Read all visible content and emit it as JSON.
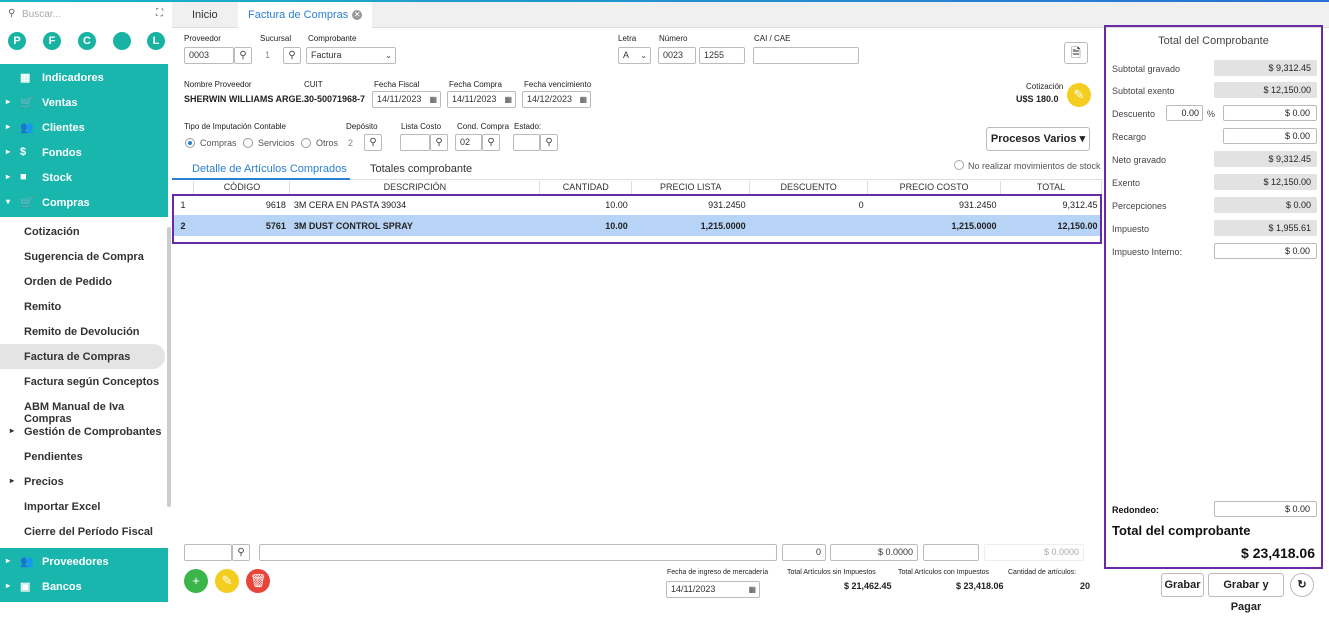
{
  "search": {
    "placeholder": "Buscar...",
    "icon": "search-icon",
    "expand_icon": "expand-icon"
  },
  "shortcuts": [
    "P",
    "F",
    "C",
    "",
    "L"
  ],
  "nav": {
    "indicadores": "Indicadores",
    "ventas": "Ventas",
    "clientes": "Clientes",
    "fondos": "Fondos",
    "stock": "Stock",
    "compras": "Compras",
    "proveedores": "Proveedores",
    "bancos": "Bancos"
  },
  "compras_items": [
    "Cotización",
    "Sugerencia de Compra",
    "Orden de Pedido",
    "Remito",
    "Remito de Devolución",
    "Factura de Compras",
    "Factura según Conceptos",
    "ABM Manual de Iva Compras",
    "Gestión de Comprobantes",
    "Pendientes",
    "Precios",
    "Importar Excel",
    "Cierre del Período Fiscal"
  ],
  "tabs": {
    "inicio": "Inicio",
    "factura": "Factura de Compras"
  },
  "form": {
    "proveedor_label": "Proveedor",
    "proveedor": "0003",
    "sucursal_label": "Sucursal",
    "sucursal": "1",
    "comprobante_label": "Comprobante",
    "comprobante": "Factura",
    "letra_label": "Letra",
    "letra": "A",
    "numero_label": "Número",
    "numero_pv": "0023",
    "numero": "1255",
    "cai_label": "CAI / CAE",
    "cai": "",
    "nombre_label": "Nombre Proveedor",
    "nombre": "SHERWIN WILLIAMS ARGE...",
    "cuit_label": "CUIT",
    "cuit": "30-50071968-7",
    "fecha_fiscal_label": "Fecha Fiscal",
    "fecha_fiscal": "14/11/2023",
    "fecha_compra_label": "Fecha Compra",
    "fecha_compra": "14/11/2023",
    "fecha_venc_label": "Fecha vencimiento",
    "fecha_venc": "14/12/2023",
    "cotizacion_label": "Cotización",
    "cotizacion": "U$S 180.0",
    "tipo_label": "Tipo de Imputación Contable",
    "tipo_opts": [
      "Compras",
      "Servicios",
      "Otros"
    ],
    "deposito_label": "Depósito",
    "deposito": "2",
    "lista_label": "Lista Costo",
    "lista": "",
    "cond_label": "Cond. Compra",
    "cond": "02",
    "estado_label": "Estado:",
    "estado": "",
    "procesos": "Procesos Varios",
    "no_stock": "No realizar movimientos de stock"
  },
  "subtabs": {
    "detalle": "Detalle de Artículos Comprados",
    "totales": "Totales comprobante"
  },
  "table": {
    "headers": [
      "",
      "CÓDIGO",
      "DESCRIPCIÓN",
      "CANTIDAD",
      "PRECIO LISTA",
      "DESCUENTO",
      "PRECIO COSTO",
      "TOTAL"
    ],
    "rows": [
      [
        "1",
        "9618",
        "3M CERA EN PASTA 39034",
        "10.00",
        "931.2450",
        "0",
        "931.2450",
        "9,312.45"
      ],
      [
        "2",
        "5761",
        "3M DUST CONTROL SPRAY",
        "10.00",
        "1,215.0000",
        "",
        "1,215.0000",
        "12,150.00"
      ]
    ]
  },
  "footer": {
    "qty": "0",
    "price": "$ 0.0000",
    "total_ro": "$ 0.0000",
    "fecha_ingreso_label": "Fecha de ingreso de mercadería",
    "fecha_ingreso": "14/11/2023",
    "sin_imp_label": "Total Artículos sin Impuestos",
    "sin_imp": "$ 21,462.45",
    "con_imp_label": "Total Artículos con Impuestos",
    "con_imp": "$ 23,418.06",
    "cant_label": "Cantidad de artículos:",
    "cant": "20"
  },
  "totals": {
    "title": "Total del Comprobante",
    "subtotal_gravado_label": "Subtotal gravado",
    "subtotal_gravado": "$ 9,312.45",
    "subtotal_exento_label": "Subtotal exento",
    "subtotal_exento": "$ 12,150.00",
    "descuento_label": "Descuento",
    "descuento_pct": "0.00",
    "pct": "%",
    "descuento": "$ 0.00",
    "recargo_label": "Recargo",
    "recargo": "$ 0.00",
    "neto_label": "Neto gravado",
    "neto": "$ 9,312.45",
    "exento_label": "Exento",
    "exento": "$ 12,150.00",
    "percepciones_label": "Percepciones",
    "percepciones": "$ 0.00",
    "impuesto_label": "Impuesto",
    "impuesto": "$ 1,955.61",
    "impuesto_int_label": "Impuesto Interno:",
    "impuesto_int": "$ 0.00",
    "redondeo_label": "Redondeo:",
    "redondeo": "$ 0.00",
    "total_label": "Total del comprobante",
    "total": "$ 23,418.06"
  },
  "buttons": {
    "grabar": "Grabar",
    "grabar_pagar": "Grabar y Pagar"
  },
  "colors": {
    "accent": "#19b6ad",
    "link": "#2a7fd4",
    "highlight": "#6a2aa5",
    "add": "#3bb54a",
    "edit": "#f3cd20",
    "delete": "#e8443a"
  }
}
